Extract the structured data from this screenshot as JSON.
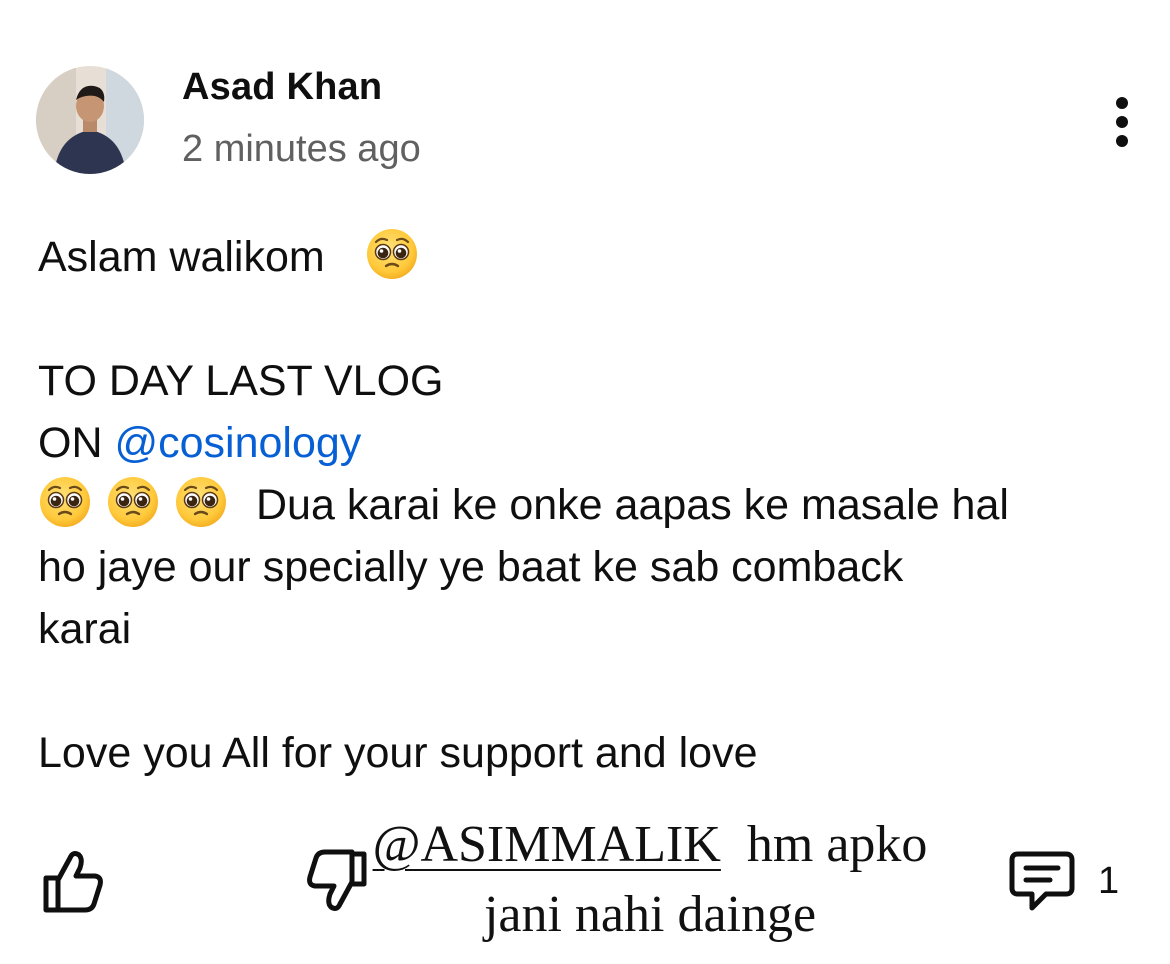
{
  "post": {
    "author": "Asad Khan",
    "timestamp": "2 minutes ago",
    "greeting": "Aslam walikom",
    "title_line": "TO DAY LAST VLOG",
    "on_prefix": "ON",
    "mention": "@cosinology",
    "dua_text": "Dua karai ke onke aapas ke masale hal",
    "dua_line2": "ho jaye our specially ye baat ke sab comback",
    "dua_line3": "karai",
    "closing": "Love you All for your support and love"
  },
  "emoji": {
    "name": "pleading-face-emoji",
    "color": "#FFC93A"
  },
  "actions": {
    "like_icon": "thumbs-up-icon",
    "dislike_icon": "thumbs-down-icon",
    "reply_icon": "comment-icon",
    "reply_count": "1",
    "more_icon": "more-vert-icon"
  },
  "overlay_text": {
    "mention": "@ASIMMALIK",
    "line1_rest": "  hm apko",
    "line2": "jani nahi dainge"
  },
  "colors": {
    "link": "#065fd4",
    "secondary_text": "#606060",
    "primary_text": "#0f0f0f"
  }
}
